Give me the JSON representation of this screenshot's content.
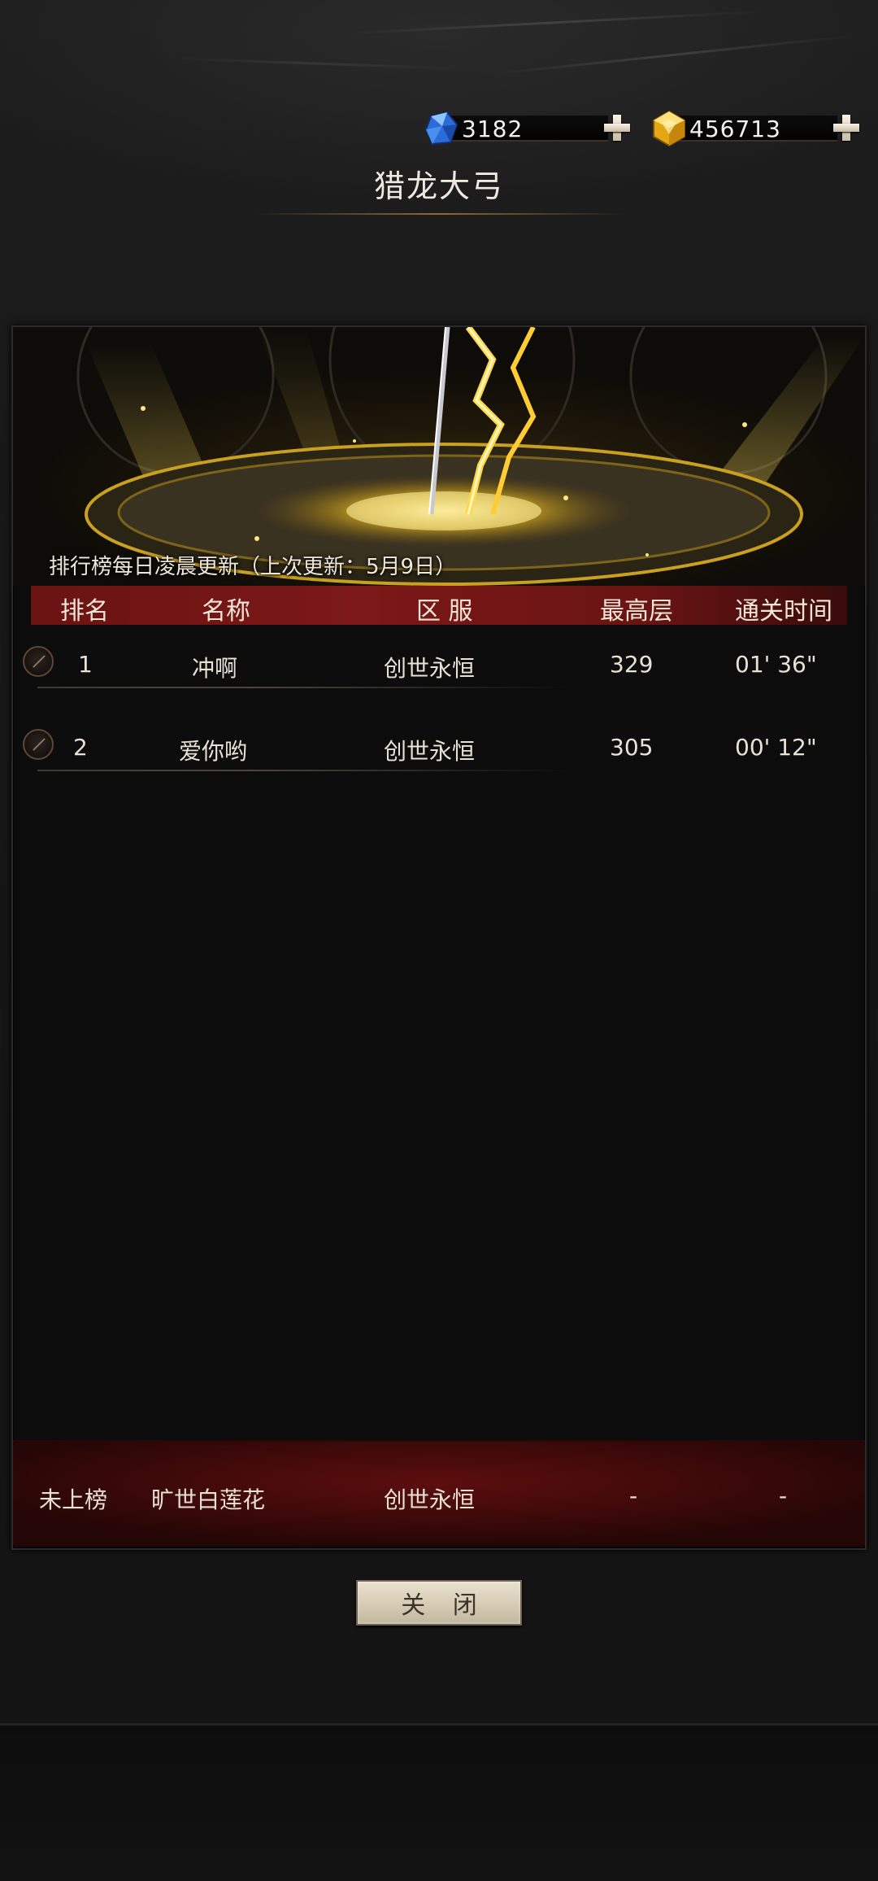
{
  "currencies": [
    {
      "icon": "blue-diamond-icon",
      "amount": "3182"
    },
    {
      "icon": "gold-diamond-icon",
      "amount": "456713"
    }
  ],
  "title": "猎龙大弓",
  "banner": {
    "note": "排行榜每日凌晨更新（上次更新：5月9日）"
  },
  "table": {
    "headers": [
      "排名",
      "名称",
      "区 服",
      "最高层",
      "通关时间"
    ],
    "rows": [
      {
        "rank": "1",
        "name": "冲啊",
        "server": "创世永恒",
        "floor": "329",
        "time": "01' 36\""
      },
      {
        "rank": "2",
        "name": "爱你哟",
        "server": "创世永恒",
        "floor": "305",
        "time": "00' 12\""
      }
    ]
  },
  "me": {
    "rank": "未上榜",
    "name": "旷世白莲花",
    "server": "创世永恒",
    "floor": "-",
    "time": "-"
  },
  "close_label": "关 闭",
  "colors": {
    "header_red": "#7c1818",
    "gold": "#f5c518",
    "panel": "#0c0c0c"
  }
}
